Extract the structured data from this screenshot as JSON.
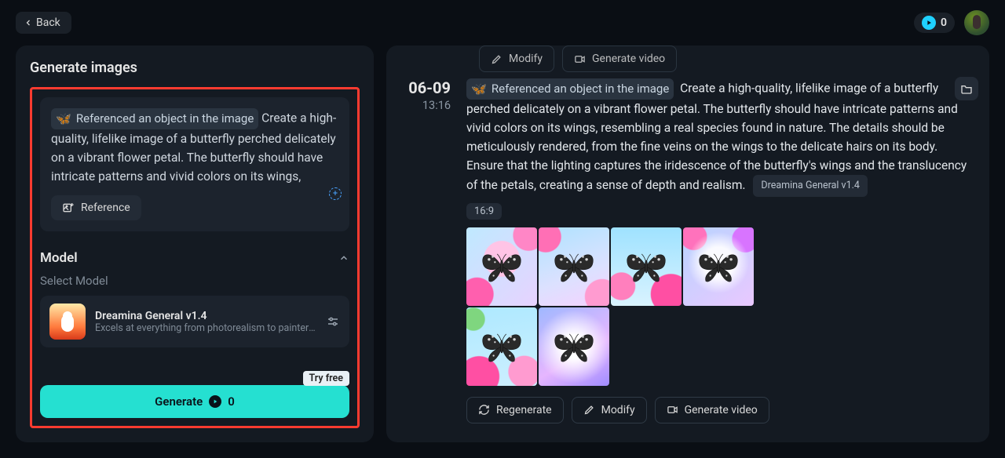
{
  "header": {
    "back_label": "Back",
    "credits": "0"
  },
  "left": {
    "title": "Generate images",
    "ref_chip": "Referenced an object in the image",
    "prompt_text": "Create a high-quality, lifelike image of a butterfly perched delicately on a vibrant flower petal. The butterfly should have intricate patterns and vivid colors on its wings,",
    "reference_button": "Reference",
    "model_section": "Model",
    "model_select_label": "Select Model",
    "model_name": "Dreamina General v1.4",
    "model_desc": "Excels at everything from photorealism to painterly style...",
    "try_free": "Try free",
    "generate_label": "Generate",
    "generate_cost": "0"
  },
  "right": {
    "top_modify": "Modify",
    "top_genvideo": "Generate video",
    "date": "06-09",
    "time": "13:16",
    "ref_chip": "Referenced an object in the image",
    "prompt_text": "Create a high-quality, lifelike image of a butterfly perched delicately on a vibrant flower petal. The butterfly should have intricate patterns and vivid colors on its wings, resembling a real species found in nature. The details should be meticulously rendered, from the fine veins on the wings to the delicate hairs on its body. Ensure that the lighting captures the iridescence of the butterfly's wings and the translucency of the petals, creating a sense of depth and realism.",
    "model_chip": "Dreamina General v1.4",
    "aspect_chip": "16:9",
    "regenerate": "Regenerate",
    "modify": "Modify",
    "genvideo": "Generate video"
  }
}
